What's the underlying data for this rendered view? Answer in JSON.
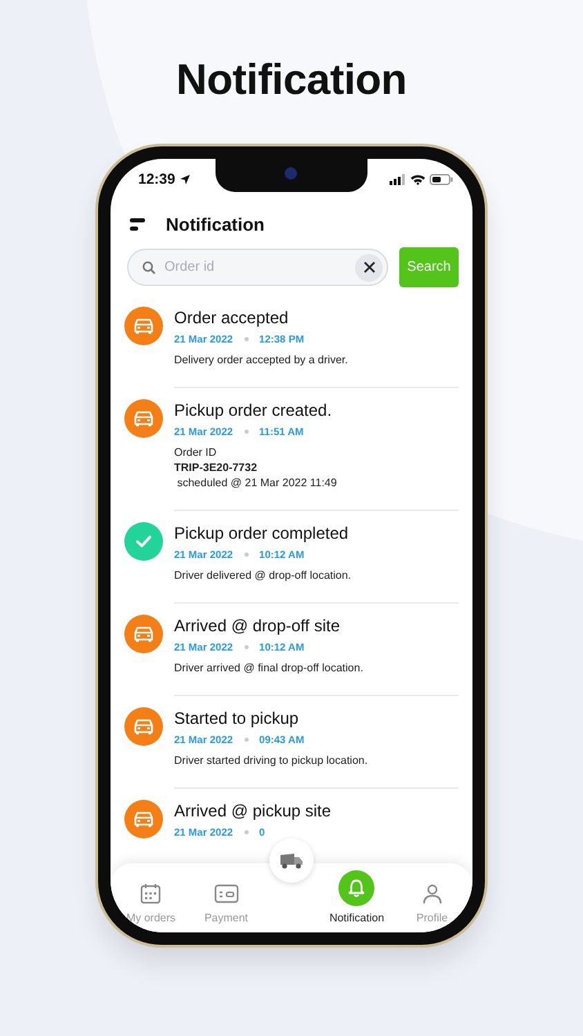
{
  "heading": "Notification",
  "status_bar": {
    "time": "12:39"
  },
  "header": {
    "title": "Notification"
  },
  "search": {
    "placeholder": "Order id",
    "button": "Search"
  },
  "notifications": [
    {
      "kind": "car",
      "title": "Order accepted",
      "date": "21 Mar 2022",
      "time": "12:38 PM",
      "lines": [
        {
          "text": "Delivery order accepted by a driver.",
          "bold": false
        }
      ]
    },
    {
      "kind": "car",
      "title": "Pickup order created.",
      "date": "21 Mar 2022",
      "time": "11:51 AM",
      "lines": [
        {
          "text": "Order ID",
          "bold": false
        },
        {
          "text": "TRIP-3E20-7732",
          "bold": true
        },
        {
          "text": " scheduled @ 21 Mar 2022 11:49",
          "bold": false
        }
      ]
    },
    {
      "kind": "check",
      "title": "Pickup order completed",
      "date": "21 Mar 2022",
      "time": "10:12 AM",
      "lines": [
        {
          "text": "Driver delivered @ drop-off location.",
          "bold": false
        }
      ]
    },
    {
      "kind": "car",
      "title": "Arrived @ drop-off site",
      "date": "21 Mar 2022",
      "time": "10:12 AM",
      "lines": [
        {
          "text": "Driver arrived @ final drop-off location.",
          "bold": false
        }
      ]
    },
    {
      "kind": "car",
      "title": "Started to pickup",
      "date": "21 Mar 2022",
      "time": "09:43 AM",
      "lines": [
        {
          "text": "Driver started driving to pickup location.",
          "bold": false
        }
      ]
    },
    {
      "kind": "car",
      "title": "Arrived @ pickup site",
      "date": "21 Mar 2022",
      "time": "0"
    }
  ],
  "tabs": [
    {
      "label": "My orders",
      "selected": false
    },
    {
      "label": "Payment",
      "selected": false
    },
    {
      "label": "Notification",
      "selected": true
    },
    {
      "label": "Profile",
      "selected": false
    }
  ]
}
